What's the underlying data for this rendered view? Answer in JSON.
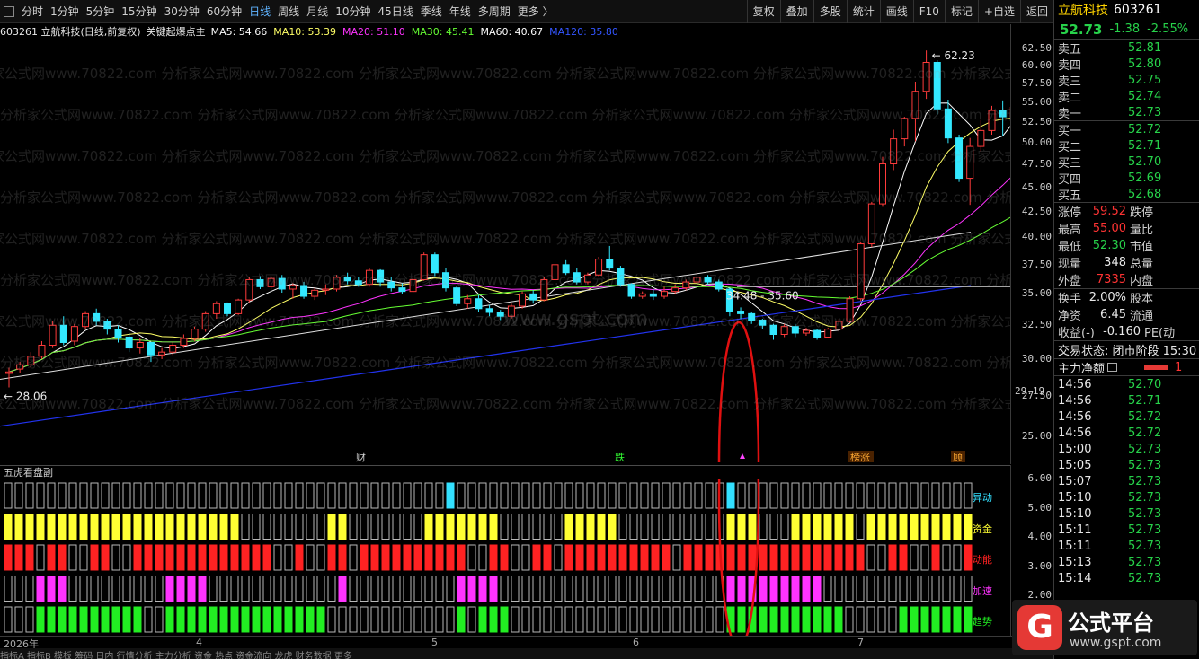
{
  "toolbar": {
    "periods": [
      "分时",
      "1分钟",
      "5分钟",
      "15分钟",
      "30分钟",
      "60分钟",
      "日线",
      "周线",
      "月线",
      "10分钟",
      "45日线",
      "季线",
      "年线",
      "多周期",
      "更多 〉"
    ],
    "active_period": "日线",
    "right_buttons": [
      "复权",
      "叠加",
      "多股",
      "统计",
      "画线",
      "F10",
      "标记",
      "+自选",
      "返回"
    ]
  },
  "chart_header": {
    "code_name": "603261 立航科技(日线,前复权)",
    "indicator": "关键起爆点主",
    "ma": [
      {
        "label": "MA5: 54.66",
        "color": "#ffffff"
      },
      {
        "label": "MA10: 53.39",
        "color": "#ffff66"
      },
      {
        "label": "MA20: 51.10",
        "color": "#ff33ff"
      },
      {
        "label": "MA30: 45.41",
        "color": "#66ff33"
      },
      {
        "label": "MA60: 40.67",
        "color": "#ffffff"
      },
      {
        "label": "MA120: 35.80",
        "color": "#3355ff"
      }
    ]
  },
  "price_axis": {
    "ticks": [
      "62.50",
      "60.00",
      "57.50",
      "55.00",
      "52.50",
      "50.00",
      "47.50",
      "45.00",
      "42.50",
      "40.00",
      "37.50",
      "35.00",
      "32.50",
      "30.00",
      "27.50",
      "25.00"
    ],
    "current_label": "29.19"
  },
  "annotations": {
    "high_label": "62.23",
    "low_label": "28.06",
    "range_label": "34.48 - 35.60",
    "markers": [
      "财",
      "跌",
      "榜涨",
      "顾"
    ]
  },
  "watermark": "分析家公式网www.70822.com",
  "mid_watermark": "www.gspt.com",
  "indicator_pane": {
    "title": "五虎看盘副",
    "rows": [
      {
        "label": "异动",
        "color": "#33e0ff"
      },
      {
        "label": "资金",
        "color": "#ffff33"
      },
      {
        "label": "动能",
        "color": "#ff2222"
      },
      {
        "label": "加速",
        "color": "#ff33ff"
      },
      {
        "label": "趋势",
        "color": "#22ee22"
      }
    ],
    "axis_ticks": [
      "6.00",
      "5.00",
      "4.00",
      "3.00",
      "2.00",
      "1.00"
    ]
  },
  "date_axis": {
    "labels": [
      "2026年",
      "4",
      "5",
      "6",
      "7"
    ]
  },
  "bottom_tabs": "指标A 指标B 模板 筹码 日内 行情分析 主力分析 资金 热点 资金流向 龙虎 财务数据 更多",
  "right_panel": {
    "name": "立航科技",
    "code": "603261",
    "price": "52.73",
    "change": "-1.38",
    "change_pct": "-2.55%",
    "asks": [
      {
        "label": "卖五",
        "price": "52.81"
      },
      {
        "label": "卖四",
        "price": "52.80"
      },
      {
        "label": "卖三",
        "price": "52.75"
      },
      {
        "label": "卖二",
        "price": "52.74"
      },
      {
        "label": "卖一",
        "price": "52.73"
      }
    ],
    "bids": [
      {
        "label": "买一",
        "price": "52.72"
      },
      {
        "label": "买二",
        "price": "52.71"
      },
      {
        "label": "买三",
        "price": "52.70"
      },
      {
        "label": "买四",
        "price": "52.69"
      },
      {
        "label": "买五",
        "price": "52.68"
      }
    ],
    "stats": [
      {
        "l1": "涨停",
        "v1": "59.52",
        "c1": "#ff3333",
        "l2": "跌停"
      },
      {
        "l1": "最高",
        "v1": "55.00",
        "c1": "#ff3333",
        "l2": "量比"
      },
      {
        "l1": "最低",
        "v1": "52.30",
        "c1": "#27d24a",
        "l2": "市值"
      },
      {
        "l1": "现量",
        "v1": "348",
        "c1": "#e8e8e8",
        "l2": "总量"
      },
      {
        "l1": "外盘",
        "v1": "7335",
        "c1": "#ff3333",
        "l2": "内盘"
      }
    ],
    "stats2": [
      {
        "l1": "换手",
        "v1": "2.00%",
        "c1": "#e8e8e8",
        "l2": "股本"
      },
      {
        "l1": "净资",
        "v1": "6.45",
        "c1": "#e8e8e8",
        "l2": "流通"
      },
      {
        "l1": "收益(-)",
        "v1": "-0.160",
        "c1": "#e8e8e8",
        "l2": "PE(动"
      }
    ],
    "trade_state": "交易状态: 闭市阶段 15:30",
    "net_label": "主力净额",
    "net_value": "1",
    "ticks": [
      {
        "t": "14:56",
        "p": "52.70"
      },
      {
        "t": "14:56",
        "p": "52.71"
      },
      {
        "t": "14:56",
        "p": "52.72"
      },
      {
        "t": "14:56",
        "p": "52.72"
      },
      {
        "t": "15:00",
        "p": "52.73"
      },
      {
        "t": "15:05",
        "p": "52.73"
      },
      {
        "t": "15:07",
        "p": "52.73"
      },
      {
        "t": "15:10",
        "p": "52.73"
      },
      {
        "t": "15:10",
        "p": "52.73"
      },
      {
        "t": "15:11",
        "p": "52.73"
      },
      {
        "t": "15:11",
        "p": "52.73"
      },
      {
        "t": "15:13",
        "p": "52.73"
      },
      {
        "t": "15:14",
        "p": "52.73"
      }
    ]
  },
  "logo": {
    "glyph": "G",
    "text": "公式平台",
    "url": "www.gspt.com"
  },
  "chart_data": {
    "type": "candlestick",
    "y_range": [
      23.5,
      64
    ],
    "scale": "log",
    "candles": [
      [
        29.0,
        29.4,
        29.1,
        28.06
      ],
      [
        29.3,
        29.8,
        29.6,
        29.0
      ],
      [
        29.6,
        30.5,
        30.2,
        29.4
      ],
      [
        30.2,
        31.3,
        31.0,
        30.0
      ],
      [
        31.0,
        32.8,
        32.5,
        30.8
      ],
      [
        32.5,
        33.2,
        31.2,
        31.0
      ],
      [
        31.3,
        32.6,
        32.4,
        31.0
      ],
      [
        32.4,
        33.6,
        33.4,
        32.2
      ],
      [
        33.4,
        33.8,
        32.8,
        32.5
      ],
      [
        32.8,
        33.0,
        32.2,
        31.8
      ],
      [
        32.2,
        32.5,
        31.6,
        31.2
      ],
      [
        31.6,
        31.9,
        30.8,
        30.5
      ],
      [
        30.8,
        31.5,
        31.2,
        30.4
      ],
      [
        31.2,
        31.2,
        30.3,
        29.8
      ],
      [
        30.3,
        30.8,
        30.5,
        30.0
      ],
      [
        30.5,
        31.2,
        31.0,
        30.3
      ],
      [
        31.0,
        31.8,
        31.5,
        30.8
      ],
      [
        31.5,
        32.4,
        32.2,
        31.3
      ],
      [
        32.2,
        33.6,
        33.4,
        32.0
      ],
      [
        33.4,
        34.4,
        34.2,
        33.0
      ],
      [
        34.2,
        34.3,
        33.4,
        33.2
      ],
      [
        33.4,
        34.6,
        34.5,
        33.3
      ],
      [
        34.5,
        36.4,
        36.2,
        34.3
      ],
      [
        36.2,
        36.5,
        35.6,
        35.4
      ],
      [
        35.6,
        36.5,
        36.3,
        35.4
      ],
      [
        36.3,
        36.6,
        35.4,
        35.1
      ],
      [
        35.4,
        35.9,
        35.7,
        34.6
      ],
      [
        35.7,
        36.0,
        34.8,
        34.6
      ],
      [
        34.8,
        35.5,
        35.3,
        34.5
      ],
      [
        35.3,
        35.8,
        35.4,
        34.9
      ],
      [
        35.4,
        36.6,
        36.4,
        35.2
      ],
      [
        36.4,
        36.8,
        36.1,
        35.8
      ],
      [
        36.1,
        36.4,
        35.8,
        35.6
      ],
      [
        35.8,
        37.2,
        37.0,
        35.6
      ],
      [
        37.0,
        37.1,
        36.0,
        35.6
      ],
      [
        36.0,
        36.4,
        35.5,
        35.2
      ],
      [
        35.5,
        35.9,
        35.2,
        35.0
      ],
      [
        35.2,
        36.4,
        36.2,
        35.1
      ],
      [
        36.2,
        38.6,
        38.4,
        36.1
      ],
      [
        38.4,
        38.6,
        36.8,
        36.5
      ],
      [
        36.8,
        37.2,
        35.5,
        35.2
      ],
      [
        35.5,
        35.7,
        34.2,
        34.0
      ],
      [
        34.2,
        34.9,
        34.6,
        33.8
      ],
      [
        34.6,
        34.9,
        33.8,
        33.5
      ],
      [
        33.8,
        34.1,
        33.5,
        33.2
      ],
      [
        33.5,
        33.7,
        33.2,
        32.9
      ],
      [
        33.2,
        34.2,
        34.0,
        33.0
      ],
      [
        34.0,
        35.2,
        35.0,
        33.8
      ],
      [
        35.0,
        35.3,
        34.5,
        34.2
      ],
      [
        34.5,
        36.4,
        36.2,
        34.4
      ],
      [
        36.2,
        37.8,
        37.5,
        36.0
      ],
      [
        37.5,
        37.9,
        36.8,
        36.6
      ],
      [
        36.8,
        37.2,
        36.0,
        35.8
      ],
      [
        36.0,
        36.8,
        36.6,
        35.8
      ],
      [
        36.6,
        38.2,
        38.0,
        36.5
      ],
      [
        38.0,
        39.2,
        37.2,
        37.0
      ],
      [
        37.2,
        37.4,
        35.8,
        35.6
      ],
      [
        35.8,
        35.9,
        34.8,
        34.6
      ],
      [
        34.8,
        35.2,
        35.0,
        34.6
      ],
      [
        35.0,
        35.4,
        34.8,
        34.5
      ],
      [
        34.8,
        35.6,
        35.2,
        34.6
      ],
      [
        35.2,
        35.8,
        35.5,
        35.0
      ],
      [
        35.5,
        36.2,
        36.0,
        35.3
      ],
      [
        36.0,
        37.0,
        36.4,
        35.9
      ],
      [
        36.4,
        36.6,
        36.0,
        35.8
      ],
      [
        36.0,
        36.2,
        35.4,
        35.2
      ],
      [
        35.4,
        35.5,
        33.6,
        33.2
      ],
      [
        33.6,
        33.9,
        33.4,
        33.0
      ],
      [
        33.4,
        33.5,
        32.9,
        32.6
      ],
      [
        32.9,
        33.0,
        32.5,
        32.2
      ],
      [
        32.5,
        32.6,
        31.8,
        31.4
      ],
      [
        31.8,
        32.6,
        32.4,
        31.6
      ],
      [
        32.4,
        32.6,
        31.9,
        31.6
      ],
      [
        31.9,
        32.3,
        32.1,
        31.7
      ],
      [
        32.1,
        32.2,
        31.6,
        31.4
      ],
      [
        31.6,
        32.3,
        32.2,
        31.5
      ],
      [
        32.2,
        33.0,
        32.8,
        32.0
      ],
      [
        32.8,
        34.8,
        34.6,
        32.7
      ],
      [
        34.6,
        39.6,
        39.4,
        34.4
      ],
      [
        39.4,
        43.5,
        43.3,
        39.1
      ],
      [
        43.3,
        48.4,
        47.6,
        43.0
      ],
      [
        47.6,
        51.6,
        50.5,
        46.9
      ],
      [
        50.5,
        53.2,
        53.0,
        49.6
      ],
      [
        53.0,
        57.8,
        56.5,
        50.2
      ],
      [
        56.5,
        62.23,
        60.5,
        55.5
      ],
      [
        60.5,
        60.8,
        54.2,
        53.5
      ],
      [
        54.2,
        55.4,
        50.6,
        50.0
      ],
      [
        50.6,
        51.0,
        46.0,
        45.6
      ],
      [
        46.0,
        50.6,
        49.6,
        43.2
      ],
      [
        49.6,
        52.8,
        51.5,
        49.0
      ],
      [
        51.5,
        54.6,
        54.0,
        51.0
      ],
      [
        54.0,
        55.3,
        53.2,
        50.8
      ],
      [
        53.2,
        54.8,
        54.4,
        52.6
      ],
      [
        54.4,
        56.6,
        56.0,
        53.8
      ],
      [
        56.0,
        58.0,
        56.6,
        55.2
      ],
      [
        56.6,
        56.8,
        55.6,
        54.6
      ],
      [
        55.6,
        55.8,
        54.2,
        53.0
      ],
      [
        54.2,
        56.2,
        54.7,
        53.2
      ],
      [
        55.2,
        55.4,
        52.73,
        52.3
      ]
    ]
  }
}
